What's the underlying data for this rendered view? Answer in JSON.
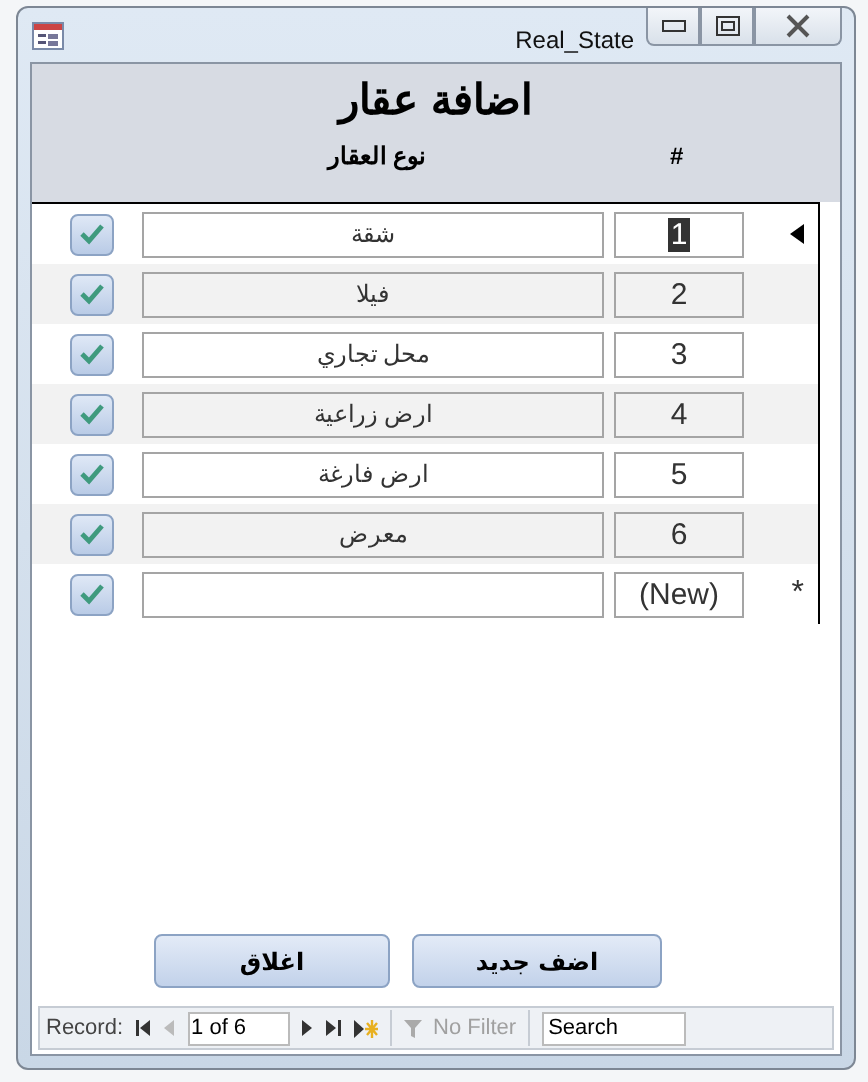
{
  "window": {
    "title": "Real_State"
  },
  "form": {
    "title": "اضافة عقار",
    "columns": [
      "#",
      "نوع العقار"
    ]
  },
  "rows": [
    {
      "number": "1",
      "type": "شقة",
      "checked": true,
      "selected": true
    },
    {
      "number": "2",
      "type": "فيلا",
      "checked": true,
      "selected": false
    },
    {
      "number": "3",
      "type": "محل تجاري",
      "checked": true,
      "selected": false
    },
    {
      "number": "4",
      "type": "ارض زراعية",
      "checked": true,
      "selected": false
    },
    {
      "number": "5",
      "type": "ارض فارغة",
      "checked": true,
      "selected": false
    },
    {
      "number": "6",
      "type": "معرض",
      "checked": true,
      "selected": false
    }
  ],
  "new_row": {
    "number": "(New)",
    "checked": true,
    "marker": "*"
  },
  "buttons": [
    "اضف جديد",
    "اغلاق"
  ],
  "nav": {
    "label": "Record:",
    "position": "1 of 6",
    "filter": "No Filter",
    "filter_disabled": true,
    "search_placeholder": "Search"
  }
}
